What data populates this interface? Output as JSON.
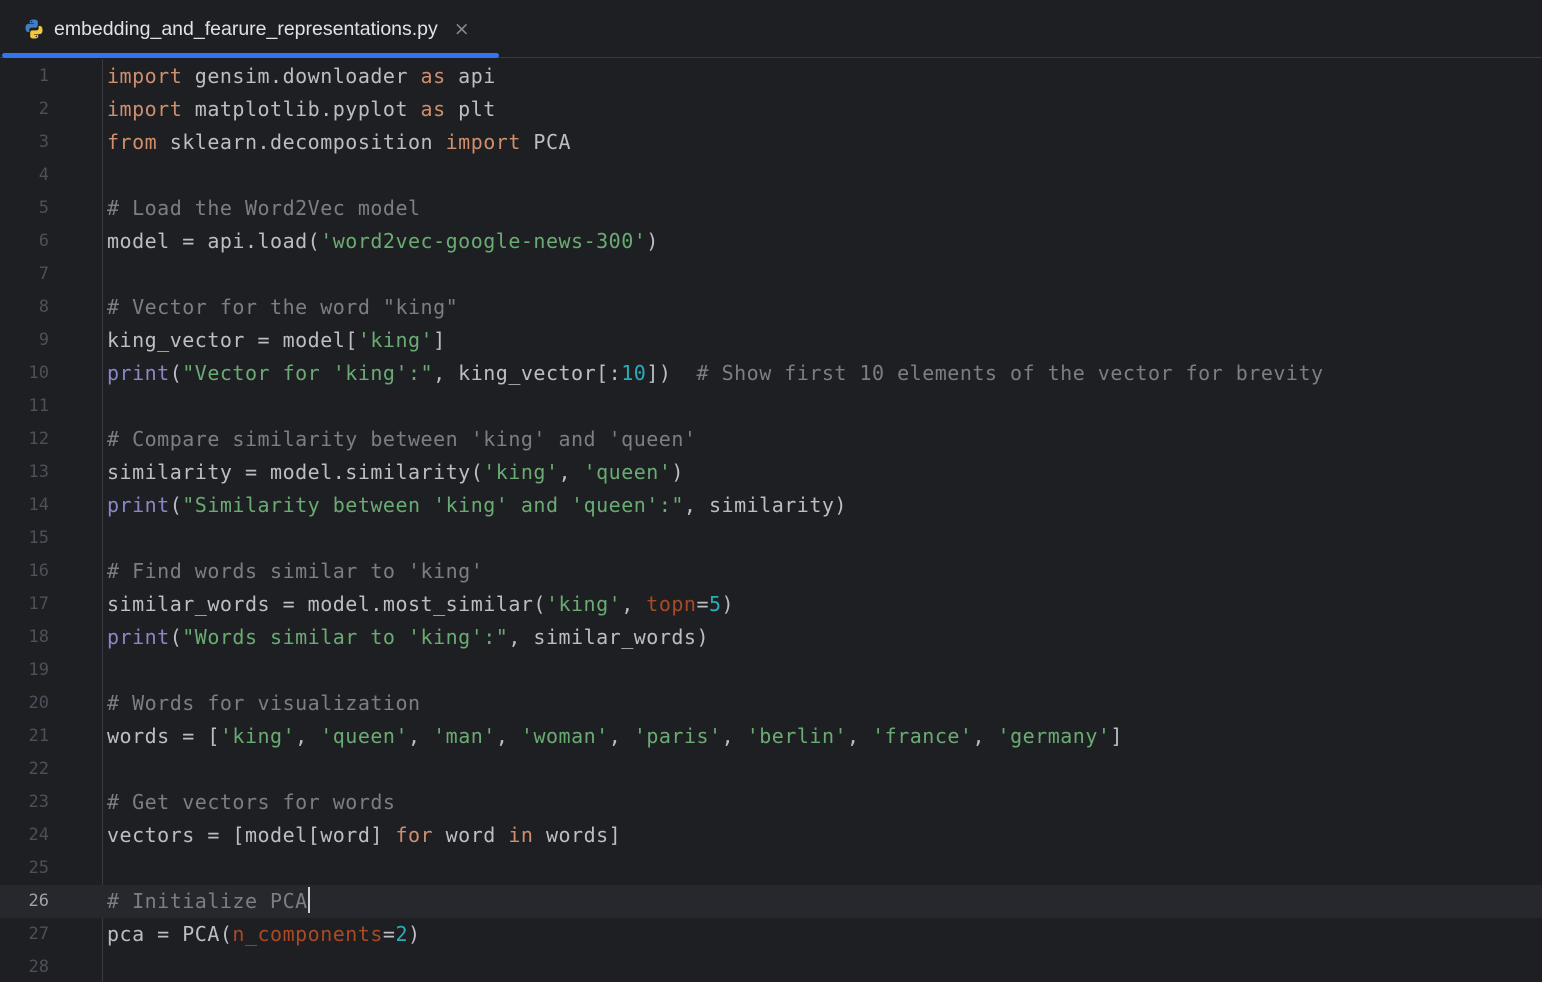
{
  "tab": {
    "filename": "embedding_and_fearure_representations.py",
    "icon": "python-file-icon",
    "close_glyph": "×"
  },
  "colors": {
    "keyword": "#cf8e6d",
    "string": "#6aab73",
    "comment": "#7a7e85",
    "builtin": "#8888c6",
    "number": "#2aacb8",
    "param": "#aa4926",
    "plain": "#bcbec4",
    "accent": "#3574f0"
  },
  "editor": {
    "current_line": 26,
    "lines": [
      {
        "n": "1",
        "tokens": [
          [
            "kw",
            "import"
          ],
          [
            "plain",
            " gensim.downloader "
          ],
          [
            "kw",
            "as"
          ],
          [
            "plain",
            " api"
          ]
        ]
      },
      {
        "n": "2",
        "tokens": [
          [
            "kw",
            "import"
          ],
          [
            "plain",
            " matplotlib.pyplot "
          ],
          [
            "kw",
            "as"
          ],
          [
            "plain",
            " plt"
          ]
        ]
      },
      {
        "n": "3",
        "tokens": [
          [
            "kw",
            "from"
          ],
          [
            "plain",
            " sklearn.decomposition "
          ],
          [
            "kw",
            "import"
          ],
          [
            "plain",
            " PCA"
          ]
        ]
      },
      {
        "n": "4",
        "tokens": []
      },
      {
        "n": "5",
        "tokens": [
          [
            "cmt",
            "# Load the Word2Vec model"
          ]
        ]
      },
      {
        "n": "6",
        "tokens": [
          [
            "plain",
            "model = api.load("
          ],
          [
            "str",
            "'word2vec-google-news-300'"
          ],
          [
            "plain",
            ")"
          ]
        ]
      },
      {
        "n": "7",
        "tokens": []
      },
      {
        "n": "8",
        "tokens": [
          [
            "cmt",
            "# Vector for the word \"king\""
          ]
        ]
      },
      {
        "n": "9",
        "tokens": [
          [
            "plain",
            "king_vector = model["
          ],
          [
            "str",
            "'king'"
          ],
          [
            "plain",
            "]"
          ]
        ]
      },
      {
        "n": "10",
        "tokens": [
          [
            "bi",
            "print"
          ],
          [
            "plain",
            "("
          ],
          [
            "str",
            "\"Vector for 'king':\""
          ],
          [
            "plain",
            ", king_vector[:"
          ],
          [
            "num",
            "10"
          ],
          [
            "plain",
            "])  "
          ],
          [
            "cmt",
            "# Show first 10 elements of the vector for brevity"
          ]
        ]
      },
      {
        "n": "11",
        "tokens": []
      },
      {
        "n": "12",
        "tokens": [
          [
            "cmt",
            "# Compare similarity between 'king' and 'queen'"
          ]
        ]
      },
      {
        "n": "13",
        "tokens": [
          [
            "plain",
            "similarity = model.similarity("
          ],
          [
            "str",
            "'king'"
          ],
          [
            "plain",
            ", "
          ],
          [
            "str",
            "'queen'"
          ],
          [
            "plain",
            ")"
          ]
        ]
      },
      {
        "n": "14",
        "tokens": [
          [
            "bi",
            "print"
          ],
          [
            "plain",
            "("
          ],
          [
            "str",
            "\"Similarity between 'king' and 'queen':\""
          ],
          [
            "plain",
            ", similarity)"
          ]
        ]
      },
      {
        "n": "15",
        "tokens": []
      },
      {
        "n": "16",
        "tokens": [
          [
            "cmt",
            "# Find words similar to 'king'"
          ]
        ]
      },
      {
        "n": "17",
        "tokens": [
          [
            "plain",
            "similar_words = model.most_similar("
          ],
          [
            "str",
            "'king'"
          ],
          [
            "plain",
            ", "
          ],
          [
            "param",
            "topn"
          ],
          [
            "plain",
            "="
          ],
          [
            "num",
            "5"
          ],
          [
            "plain",
            ")"
          ]
        ]
      },
      {
        "n": "18",
        "tokens": [
          [
            "bi",
            "print"
          ],
          [
            "plain",
            "("
          ],
          [
            "str",
            "\"Words similar to 'king':\""
          ],
          [
            "plain",
            ", similar_words)"
          ]
        ]
      },
      {
        "n": "19",
        "tokens": []
      },
      {
        "n": "20",
        "tokens": [
          [
            "cmt",
            "# Words for visualization"
          ]
        ]
      },
      {
        "n": "21",
        "tokens": [
          [
            "plain",
            "words = ["
          ],
          [
            "str",
            "'king'"
          ],
          [
            "plain",
            ", "
          ],
          [
            "str",
            "'queen'"
          ],
          [
            "plain",
            ", "
          ],
          [
            "str",
            "'man'"
          ],
          [
            "plain",
            ", "
          ],
          [
            "str",
            "'woman'"
          ],
          [
            "plain",
            ", "
          ],
          [
            "str",
            "'paris'"
          ],
          [
            "plain",
            ", "
          ],
          [
            "str",
            "'berlin'"
          ],
          [
            "plain",
            ", "
          ],
          [
            "str",
            "'france'"
          ],
          [
            "plain",
            ", "
          ],
          [
            "str",
            "'germany'"
          ],
          [
            "plain",
            "]"
          ]
        ]
      },
      {
        "n": "22",
        "tokens": []
      },
      {
        "n": "23",
        "tokens": [
          [
            "cmt",
            "# Get vectors for words"
          ]
        ]
      },
      {
        "n": "24",
        "tokens": [
          [
            "plain",
            "vectors = [model[word] "
          ],
          [
            "kw",
            "for"
          ],
          [
            "plain",
            " word "
          ],
          [
            "kw",
            "in"
          ],
          [
            "plain",
            " words]"
          ]
        ]
      },
      {
        "n": "25",
        "tokens": []
      },
      {
        "n": "26",
        "tokens": [
          [
            "cmt",
            "# Initialize PCA"
          ]
        ]
      },
      {
        "n": "27",
        "tokens": [
          [
            "plain",
            "pca = PCA("
          ],
          [
            "param",
            "n_components"
          ],
          [
            "plain",
            "="
          ],
          [
            "num",
            "2"
          ],
          [
            "plain",
            ")"
          ]
        ]
      },
      {
        "n": "28",
        "tokens": []
      }
    ]
  }
}
